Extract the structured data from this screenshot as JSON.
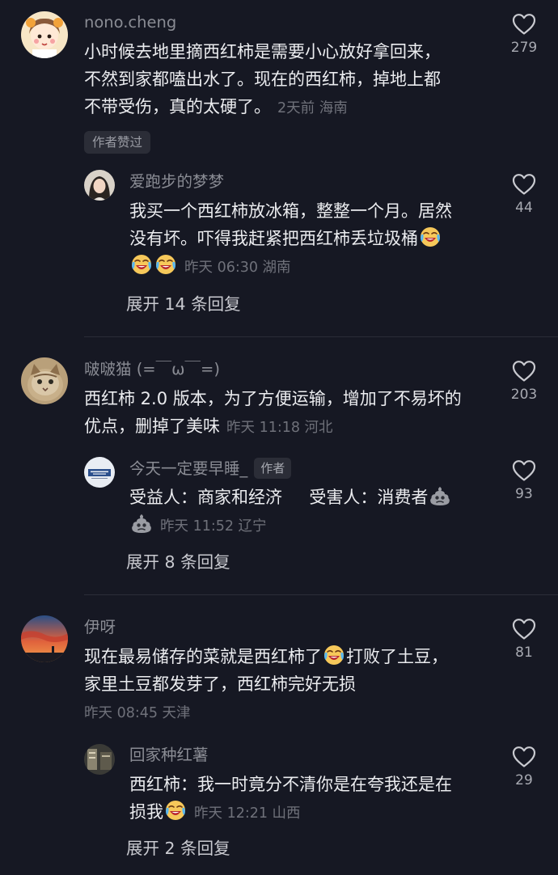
{
  "threads": [
    {
      "comment": {
        "username": "nono.cheng",
        "lines": [
          "小时候去地里摘西红柿是需要小心放好拿回来，",
          "不然到家都嗑出水了。现在的西红柿，掉地上都",
          "不带受伤，真的太硬了。"
        ],
        "meta": "2天前 海南",
        "likes": "279",
        "badge": "作者赞过"
      },
      "reply": {
        "username": "爱跑步的梦梦",
        "line1": "我买一个西红柿放冰箱，整整一个月。居然",
        "line2": "没有坏。吓得我赶紧把西红柿丢垃圾桶",
        "meta": "昨天 06:30 湖南",
        "likes": "44",
        "emojis": [
          "crying-laugh",
          "crying-laugh",
          "crying-laugh"
        ]
      },
      "expand_label": "展开 14 条回复"
    },
    {
      "comment": {
        "username": "啵啵猫 (=￣ω￣=)",
        "line1": "西红柿 2.0 版本，为了方便运输，增加了不易坏的",
        "line2": "优点，删掉了美味",
        "meta": "昨天 11:18 河北",
        "likes": "203"
      },
      "reply": {
        "username": "今天一定要早睡_",
        "author_tag": "作者",
        "line1": "受益人：商家和经济     受害人：消费者",
        "meta": "昨天 11:52 辽宁",
        "likes": "93",
        "emojis": [
          "grey-pile",
          "grey-pile"
        ]
      },
      "expand_label": "展开 8 条回复"
    },
    {
      "comment": {
        "username": "伊呀",
        "line1a": "现在最易储存的菜就是西红柿了",
        "line1b": "打败了土豆，",
        "line2": "家里土豆都发芽了，西红柿完好无损",
        "meta": "昨天 08:45 天津",
        "likes": "81",
        "emojis": [
          "crying-laugh"
        ]
      },
      "reply": {
        "username": "回家种红薯",
        "line1": "西红柿：我一时竟分不清你是在夸我还是在",
        "line2": "损我",
        "meta": "昨天 12:21 山西",
        "likes": "29",
        "emojis": [
          "crying-laugh"
        ]
      },
      "expand_label": "展开 2 条回复"
    }
  ],
  "icons": {
    "like": "heart-outline-icon"
  },
  "colors": {
    "background": "#161823",
    "muted": "#8a8c94"
  }
}
